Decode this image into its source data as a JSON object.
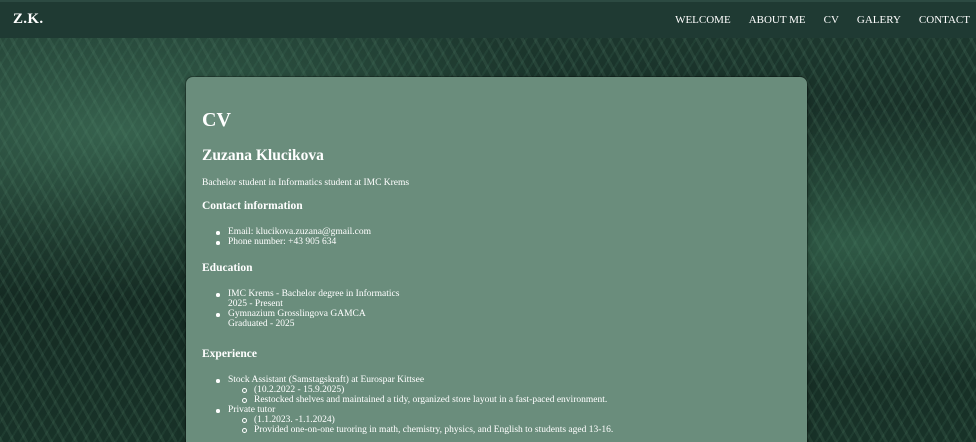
{
  "brand": "Z.K.",
  "nav": {
    "items": [
      "WELCOME",
      "ABOUT ME",
      "CV",
      "GALERY",
      "CONTACT"
    ]
  },
  "cv": {
    "title": "CV",
    "name": "Zuzana Klucikova",
    "subtitle": "Bachelor student in Informatics student at IMC Krems",
    "contact": {
      "heading": "Contact information",
      "email": "Email: klucikova.zuzana@gmail.com",
      "phone": "Phone number: +43 905 634"
    },
    "education": {
      "heading": "Education",
      "items": [
        {
          "title": "IMC Krems - Bachelor degree in Informatics",
          "detail": "2025 - Present"
        },
        {
          "title": "Gymnazium Grosslingova GAMCA",
          "detail": "Graduated - 2025"
        }
      ]
    },
    "experience": {
      "heading": "Experience",
      "items": [
        {
          "title": "Stock Assistant (Samstagskraft) at Eurospar Kittsee",
          "sub": [
            "(10.2.2022 - 15.9.2025)",
            "Restocked shelves and maintained a tidy, organized store layout in a fast-paced environment."
          ]
        },
        {
          "title": "Private tutor",
          "sub": [
            "(1.1.2023. -1.1.2024)",
            "Provided one-on-one turoring in math, chemistry, physics, and English to students aged 13-16."
          ]
        }
      ]
    }
  }
}
